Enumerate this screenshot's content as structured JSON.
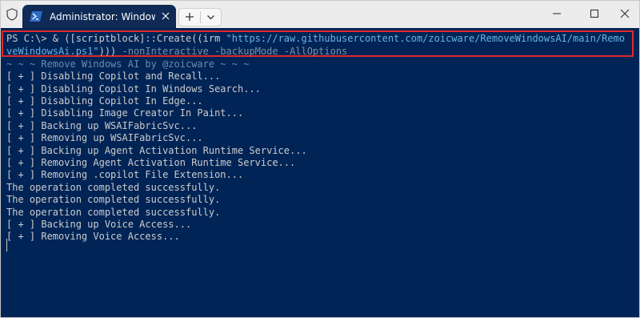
{
  "window": {
    "tab_title": "Administrator: Windows PowerShell",
    "tab_close_icon": "close-icon",
    "new_tab_icon": "plus-icon",
    "dropdown_icon": "chevron-down-icon",
    "controls": [
      "minimize-icon",
      "maximize-icon",
      "close-icon"
    ]
  },
  "terminal": {
    "background": "#012456",
    "highlight_color": "#e0282c",
    "command": {
      "prompt": "PS C:\\> ",
      "prefix": "& ([scriptblock]::Create((irm ",
      "url_part1": "\"https://raw.githubusercontent.com/zoicware/RemoveWindowsAI/main/Remo",
      "url_part2": "veWindowsAi.ps1\"",
      "suffix": ")))",
      "params": " -nonInteractive -backupMode -AllOptions"
    },
    "banner": "~ ~ ~ Remove Windows AI by @zoicware ~ ~ ~",
    "output_lines": [
      "[ + ] Disabling Copilot and Recall...",
      "[ + ] Disabling Copilot In Windows Search...",
      "[ + ] Disabling Copilot In Edge...",
      "[ + ] Disabling Image Creator In Paint...",
      "[ + ] Backing up WSAIFabricSvc...",
      "[ + ] Removing up WSAIFabricSvc...",
      "[ + ] Backing up Agent Activation Runtime Service...",
      "[ + ] Removing Agent Activation Runtime Service...",
      "[ + ] Removing .copilot File Extension...",
      "The operation completed successfully.",
      "The operation completed successfully.",
      "The operation completed successfully.",
      "[ + ] Backing up Voice Access...",
      "[ + ] Removing Voice Access..."
    ]
  }
}
